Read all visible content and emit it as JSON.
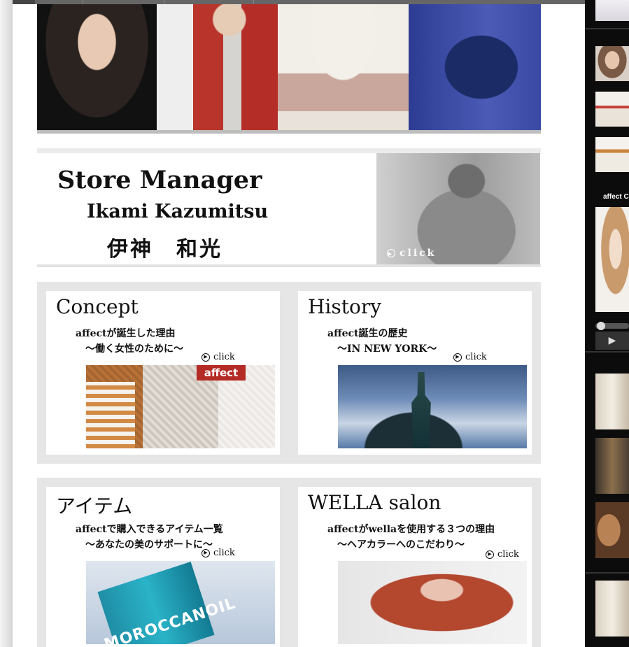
{
  "manager_banner": {
    "title": "Store Manager",
    "name_en": "Ikami Kazumitsu",
    "name_jp": "伊神　和光",
    "click_label": "click"
  },
  "cards": {
    "concept": {
      "title": "Concept",
      "line1": "affectが誕生した理由",
      "line2": "〜働く女性のために〜",
      "click_label": "click",
      "image_sign": "affect"
    },
    "history": {
      "title": "History",
      "line1": "affect誕生の歴史",
      "line2": "〜IN NEW YORK〜",
      "click_label": "click"
    },
    "items": {
      "title": "アイテム",
      "line1": "affectで購入できるアイテム一覧",
      "line2": "〜あなたの美のサポートに〜",
      "click_label": "click",
      "image_label": "MOROCCANOIL"
    },
    "wella": {
      "title": "WELLA salon",
      "line1": "affectがwellaを使用する３つの理由",
      "line2": "〜ヘアカラーへのこだわり〜",
      "click_label": "click"
    }
  },
  "sidebar": {
    "video_caption": "affect Co",
    "play_icon": "play-icon"
  },
  "colors": {
    "page_bg": "#ececec",
    "card_band": "#e6e6e6",
    "sidebar_bg": "#0c0c0c"
  }
}
